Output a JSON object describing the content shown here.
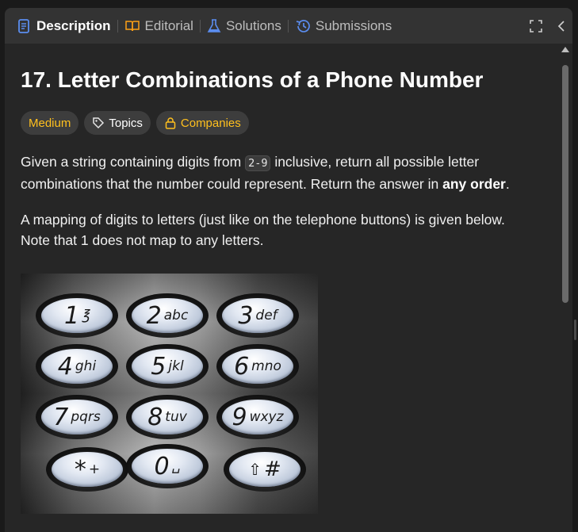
{
  "tabs": [
    {
      "label": "Description",
      "icon": "description-icon",
      "active": true
    },
    {
      "label": "Editorial",
      "icon": "book-icon",
      "active": false
    },
    {
      "label": "Solutions",
      "icon": "flask-icon",
      "active": false
    },
    {
      "label": "Submissions",
      "icon": "history-icon",
      "active": false
    }
  ],
  "problem": {
    "title": "17. Letter Combinations of a Phone Number",
    "difficulty": "Medium",
    "topics_label": "Topics",
    "companies_label": "Companies",
    "p1_before": "Given a string containing digits from ",
    "p1_code": "2-9",
    "p1_middle": " inclusive, return all possible letter combinations that the number could represent. Return the answer in ",
    "p1_bold": "any order",
    "p1_after": ".",
    "p2": "A mapping of digits to letters (just like on the telephone buttons) is given below. Note that 1 does not map to any letters."
  },
  "keypad": {
    "keys": [
      {
        "digit": "1",
        "letters": "℥"
      },
      {
        "digit": "2",
        "letters": "abc"
      },
      {
        "digit": "3",
        "letters": "def"
      },
      {
        "digit": "4",
        "letters": "ghi"
      },
      {
        "digit": "5",
        "letters": "jkl"
      },
      {
        "digit": "6",
        "letters": "mno"
      },
      {
        "digit": "7",
        "letters": "pqrs"
      },
      {
        "digit": "8",
        "letters": "tuv"
      },
      {
        "digit": "9",
        "letters": "wxyz"
      },
      {
        "digit": "*",
        "letters": "+"
      },
      {
        "digit": "0",
        "letters": "␣"
      },
      {
        "digit": "⇧",
        "letters": "#"
      }
    ]
  },
  "colors": {
    "accent_blue": "#5b8def",
    "medium": "#ffc01e",
    "background": "#262626"
  }
}
